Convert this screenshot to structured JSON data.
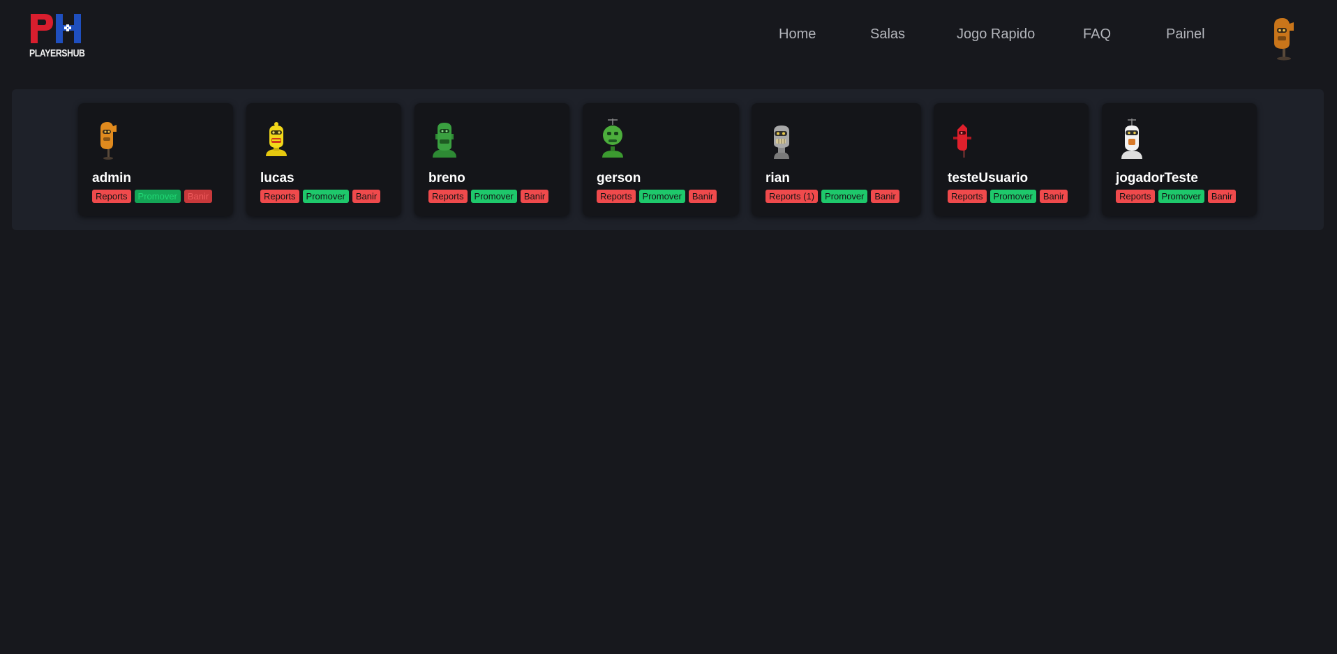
{
  "brand": {
    "logo_text": "PLAYERSHUB",
    "colors": {
      "red": "#d91e2e",
      "blue": "#1f4fbf"
    }
  },
  "nav": {
    "links": [
      {
        "label": "Home"
      },
      {
        "label": "Salas"
      },
      {
        "label": "Jogo Rapido"
      },
      {
        "label": "FAQ"
      },
      {
        "label": "Painel"
      }
    ],
    "avatar_icon": "robot-avatar-orange"
  },
  "users": [
    {
      "name": "admin",
      "reports_label": "Reports",
      "promote_label": "Promover",
      "ban_label": "Banir",
      "actions_disabled": true,
      "avatar_color": "#e08a1e",
      "avatar_icon": "robot-avatar-orange"
    },
    {
      "name": "lucas",
      "reports_label": "Reports",
      "promote_label": "Promover",
      "ban_label": "Banir",
      "actions_disabled": false,
      "avatar_color": "#f2d81a",
      "avatar_icon": "robot-avatar-yellow"
    },
    {
      "name": "breno",
      "reports_label": "Reports",
      "promote_label": "Promover",
      "ban_label": "Banir",
      "actions_disabled": false,
      "avatar_color": "#3aa040",
      "avatar_icon": "robot-avatar-green"
    },
    {
      "name": "gerson",
      "reports_label": "Reports",
      "promote_label": "Promover",
      "ban_label": "Banir",
      "actions_disabled": false,
      "avatar_color": "#4cae3c",
      "avatar_icon": "robot-avatar-green-antenna"
    },
    {
      "name": "rian",
      "reports_label": "Reports (1)",
      "promote_label": "Promover",
      "ban_label": "Banir",
      "actions_disabled": false,
      "avatar_color": "#9a9a9a",
      "avatar_icon": "robot-avatar-gray"
    },
    {
      "name": "testeUsuario",
      "reports_label": "Reports",
      "promote_label": "Promover",
      "ban_label": "Banir",
      "actions_disabled": false,
      "avatar_color": "#e0202c",
      "avatar_icon": "robot-avatar-red"
    },
    {
      "name": "jogadorTeste",
      "reports_label": "Reports",
      "promote_label": "Promover",
      "ban_label": "Banir",
      "actions_disabled": false,
      "avatar_color": "#f2f2f2",
      "avatar_icon": "robot-avatar-white"
    }
  ]
}
